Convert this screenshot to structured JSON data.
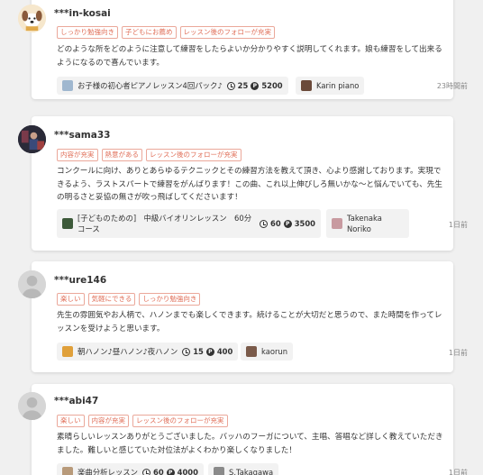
{
  "reviews": [
    {
      "user": "***in-kosai",
      "tags": [
        "しっかり勉強向き",
        "子どもにお薦め",
        "レッスン後のフォローが充実"
      ],
      "text": "どのような所をどのように注意して練習をしたらよいか分かりやすく説明してくれます。娘も練習をして出来るようになるので喜んでいます。",
      "course": "お子様の初心者ピアノレッスン4回パック♪",
      "duration": "25",
      "points": "5200",
      "teacher": "Karin piano",
      "ago": "23時間前",
      "avatar": "dog-avatar-icon"
    },
    {
      "user": "***sama33",
      "tags": [
        "内容が充実",
        "熱意がある",
        "レッスン後のフォローが充実"
      ],
      "text": "コンクールに向け、ありとあらゆるテクニックとその練習方法を教えて頂き、心より感謝しております。実現できるよう、ラストスパートで練習をがんばります！この曲、これ以上伸びしろ無いかな〜と悩んでいても、先生の明るさと妥協の無さが吹っ飛ばしてくださいます！",
      "course": "[子どものための]　中級バイオリンレッスン　60分コース",
      "duration": "60",
      "points": "3500",
      "teacher": "Takenaka Noriko",
      "ago": "1日前",
      "avatar": "photo-avatar-icon"
    },
    {
      "user": "***ure146",
      "tags": [
        "楽しい",
        "気軽にできる",
        "しっかり勉強向き"
      ],
      "text": "先生の雰囲気やお人柄で、ハノンまでも楽しくできます。続けることが大切だと思うので、また時間を作ってレッスンを受けようと思います。",
      "course": "朝ハノン♪昼ハノン♪夜ハノン",
      "duration": "15",
      "points": "400",
      "teacher": "kaorun",
      "ago": "1日前",
      "avatar": "default-avatar-icon"
    },
    {
      "user": "***abi47",
      "tags": [
        "楽しい",
        "内容が充実",
        "レッスン後のフォローが充実"
      ],
      "text": "素晴らしいレッスンありがとうございました。バッハのフーガについて、主唱、答唱など詳しく教えていただきました。難しいと感じていた対位法がよくわかり楽しくなりました！",
      "course": "楽曲分析レッスン",
      "duration": "60",
      "points": "4000",
      "teacher": "S.Takagawa",
      "ago": "1日前",
      "avatar": "default-avatar-icon"
    }
  ],
  "icons": {
    "clock": "clock-icon",
    "points": "points-icon",
    "points_glyph": "P"
  },
  "colors": {
    "tag": "#e0705a",
    "background": "#f0f0f0",
    "chip": "#f2f2f2"
  }
}
